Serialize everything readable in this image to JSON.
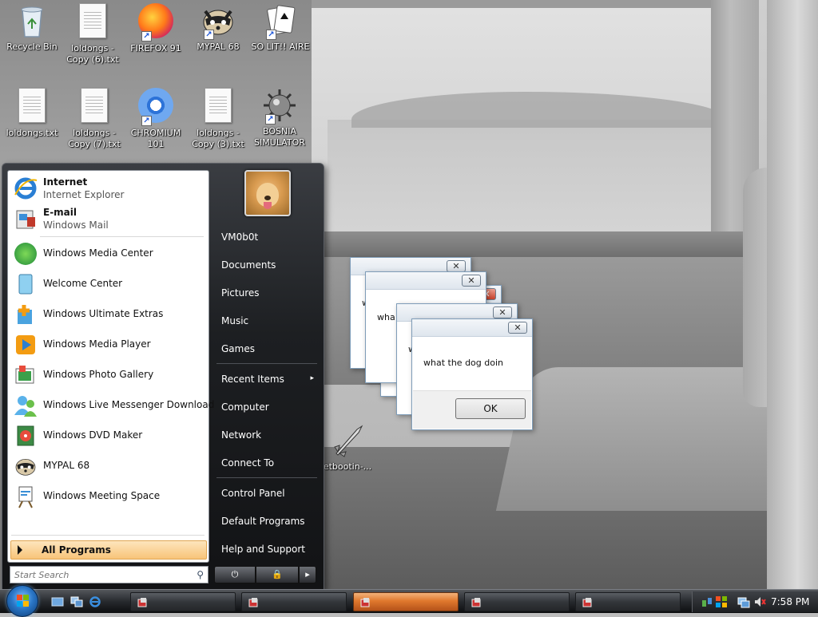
{
  "desktop": {
    "icons": [
      {
        "label": "Recycle Bin",
        "icon": "recycle-bin-icon"
      },
      {
        "label": "loldongs - Copy (6).txt",
        "icon": "text-file-icon"
      },
      {
        "label": "FIREFOX 91",
        "icon": "firefox-icon"
      },
      {
        "label": "MYPAL 68",
        "icon": "mypal-raccoon-icon"
      },
      {
        "label": "SO LIT!! AIRE",
        "icon": "solitaire-cards-icon"
      },
      {
        "label": "loldongs.txt",
        "icon": "text-file-icon"
      },
      {
        "label": "loldongs - Copy (7).txt",
        "icon": "text-file-icon"
      },
      {
        "label": "CHROMIUM 101",
        "icon": "chromium-icon"
      },
      {
        "label": "loldongs - Copy (3).txt",
        "icon": "text-file-icon"
      },
      {
        "label": "BOSNIA SIMULATOR",
        "icon": "minesweeper-mine-icon"
      },
      {
        "label": "etbootin-...",
        "icon": "unetbootin-rocket-icon"
      }
    ]
  },
  "dialogs": {
    "message": "what the dog doin",
    "ok_label": "OK",
    "close_glyph": "✕",
    "stub_text_1": "w",
    "stub_text_2": "wha",
    "stub_text_3": "w"
  },
  "start_menu": {
    "pinned": [
      {
        "title": "Internet",
        "subtitle": "Internet Explorer",
        "icon": "internet-explorer-icon"
      },
      {
        "title": "E-mail",
        "subtitle": "Windows Mail",
        "icon": "windows-mail-icon"
      }
    ],
    "recent": [
      {
        "label": "Windows Media Center",
        "icon": "media-center-icon"
      },
      {
        "label": "Welcome Center",
        "icon": "welcome-center-icon"
      },
      {
        "label": "Windows Ultimate Extras",
        "icon": "ultimate-extras-icon"
      },
      {
        "label": "Windows Media Player",
        "icon": "media-player-icon"
      },
      {
        "label": "Windows Photo Gallery",
        "icon": "photo-gallery-icon"
      },
      {
        "label": "Windows Live Messenger Download",
        "icon": "messenger-icon"
      },
      {
        "label": "Windows DVD Maker",
        "icon": "dvd-maker-icon"
      },
      {
        "label": "MYPAL 68",
        "icon": "mypal-raccoon-icon"
      },
      {
        "label": "Windows Meeting Space",
        "icon": "meeting-space-icon"
      }
    ],
    "all_programs": "All Programs",
    "search_placeholder": "Start Search",
    "right": [
      {
        "label": "VM0b0t"
      },
      {
        "label": "Documents"
      },
      {
        "label": "Pictures"
      },
      {
        "label": "Music"
      },
      {
        "label": "Games"
      },
      {
        "label": "Recent Items",
        "submenu": "▸"
      },
      {
        "label": "Computer"
      },
      {
        "label": "Network"
      },
      {
        "label": "Connect To"
      },
      {
        "label": "Control Panel"
      },
      {
        "label": "Default Programs"
      },
      {
        "label": "Help and Support"
      }
    ]
  },
  "taskbar": {
    "clock": "7:58 PM",
    "buttons": 5,
    "active_index": 2
  },
  "colors": {
    "accent_orange": "#f8c479",
    "taskbar_dark": "#272a2e",
    "start_orb_blue": "#2a76c6"
  }
}
